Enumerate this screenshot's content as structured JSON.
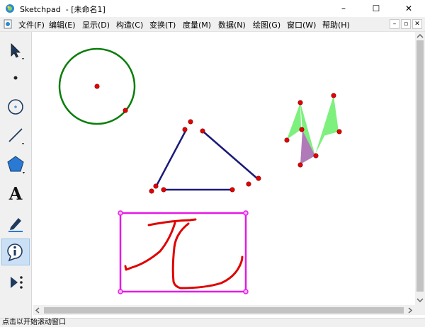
{
  "window": {
    "title": "Sketchpad  - [未命名1]",
    "controls": {
      "minimize": "–",
      "maximize": "☐",
      "close": "✕"
    }
  },
  "menu": {
    "items": [
      "文件(F)",
      "编辑(E)",
      "显示(D)",
      "构造(C)",
      "变换(T)",
      "度量(M)",
      "数据(N)",
      "绘图(G)",
      "窗口(W)",
      "帮助(H)"
    ],
    "doc_controls": {
      "minimize": "–",
      "restore": "▫",
      "close": "✕"
    }
  },
  "toolbar": {
    "tools": [
      "arrow-select-tool",
      "point-tool",
      "compass-tool",
      "straightedge-tool",
      "polygon-tool",
      "text-tool",
      "marker-tool",
      "information-tool",
      "custom-tool"
    ],
    "text_tool_glyph": "A",
    "selected": "information-tool"
  },
  "status": {
    "text": "点击以开始滚动窗口"
  },
  "colors": {
    "circle": "#0a7d0a",
    "triangle": "#1a1a7a",
    "rectangle": "#e619e6",
    "ink": "#e00000",
    "point": "#e60000",
    "shape_green": "#7ef07e",
    "shape_purple": "#b07ab8"
  }
}
